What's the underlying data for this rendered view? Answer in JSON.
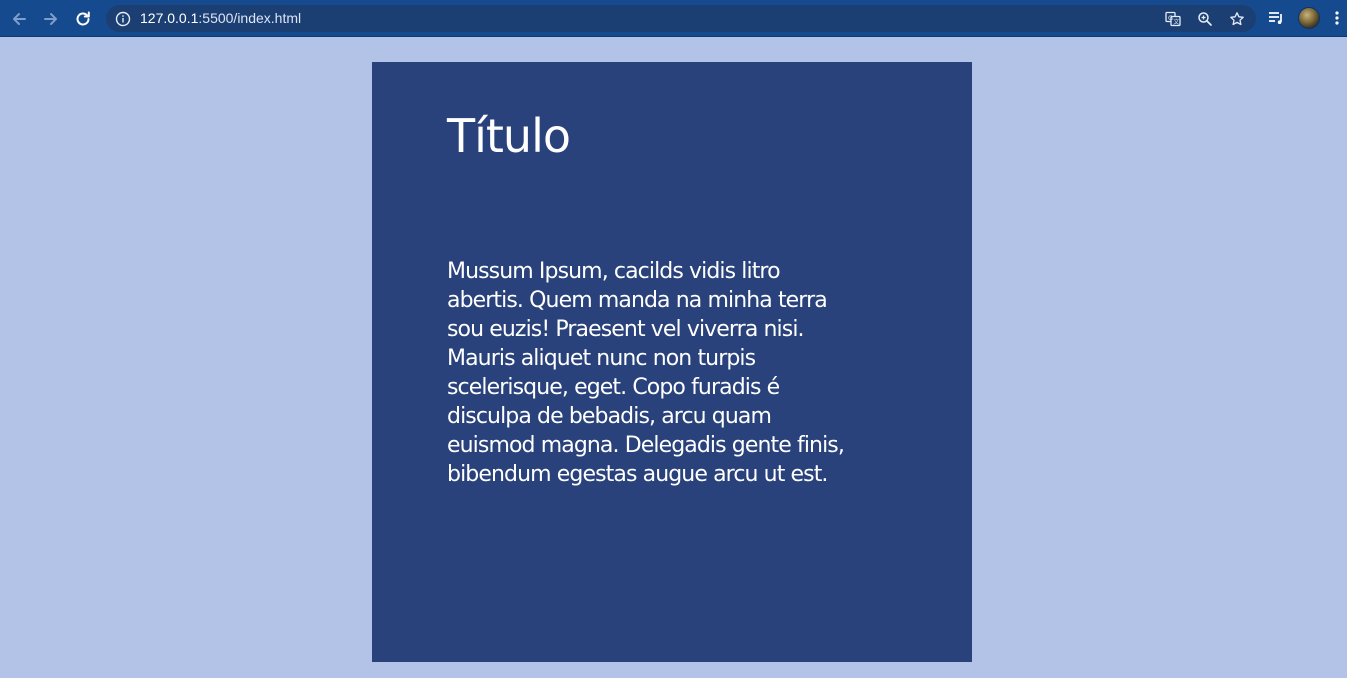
{
  "browser": {
    "url": {
      "host": "127.0.0.1",
      "rest": ":5500/index.html"
    },
    "icons": {
      "back": "arrow-left-icon",
      "forward": "arrow-right-icon",
      "reload": "reload-icon",
      "site_info": "info-icon",
      "translate": "translate-icon",
      "zoom": "zoom-icon",
      "bookmark": "star-icon",
      "media": "playlist-icon",
      "profile": "avatar",
      "menu": "kebab-menu-icon"
    },
    "colors": {
      "toolbar": "#154a8f",
      "omnibox": "#1c3f73"
    }
  },
  "page": {
    "background": "#b3c3e8",
    "card": {
      "title": "Título",
      "body_lines": [
        "Mussum Ipsum, cacilds vidis litro",
        "abertis. Quem manda na minha terra",
        "sou euzis! Praesent vel viverra nisi.",
        "Mauris aliquet nunc non turpis",
        "scelerisque, eget. Copo furadis é",
        "disculpa de bebadis, arcu quam",
        "euismod magna. Delegadis gente finis,",
        "bibendum egestas augue arcu ut est."
      ],
      "background": "#29427b",
      "text_color": "#ffffff"
    }
  }
}
